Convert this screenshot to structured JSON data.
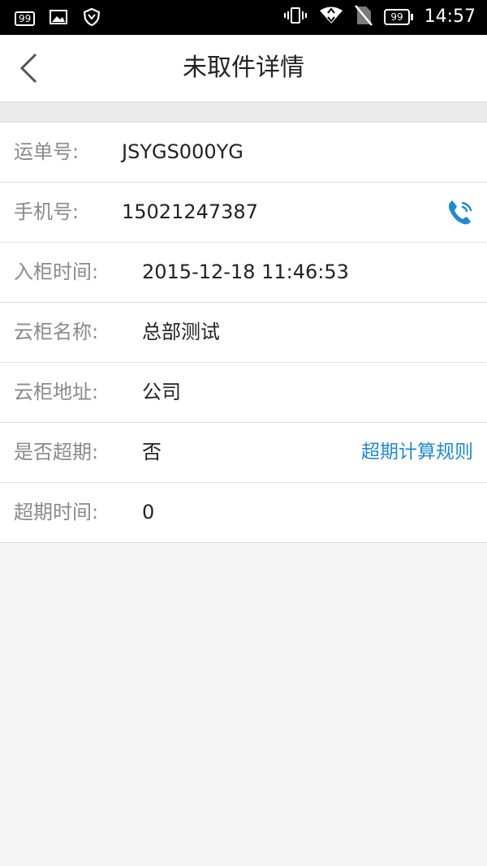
{
  "status_bar": {
    "notification_badge": "99",
    "battery_level": "99",
    "time": "14:57"
  },
  "header": {
    "title": "未取件详情"
  },
  "details": {
    "waybill": {
      "label": "运单号:",
      "value": "JSYGS000YG"
    },
    "phone": {
      "label": "手机号:",
      "value": "15021247387"
    },
    "storage_time": {
      "label": "入柜时间:",
      "value": "2015-12-18 11:46:53"
    },
    "locker_name": {
      "label": "云柜名称:",
      "value": "总部测试"
    },
    "locker_address": {
      "label": "云柜地址:",
      "value": "公司"
    },
    "overdue": {
      "label": "是否超期:",
      "value": "否",
      "link": "超期计算规则"
    },
    "overdue_time": {
      "label": "超期时间:",
      "value": "0"
    }
  },
  "colors": {
    "accent": "#1f8ad6",
    "label": "#8a8a8a",
    "text": "#222222",
    "background": "#f5f5f5"
  }
}
